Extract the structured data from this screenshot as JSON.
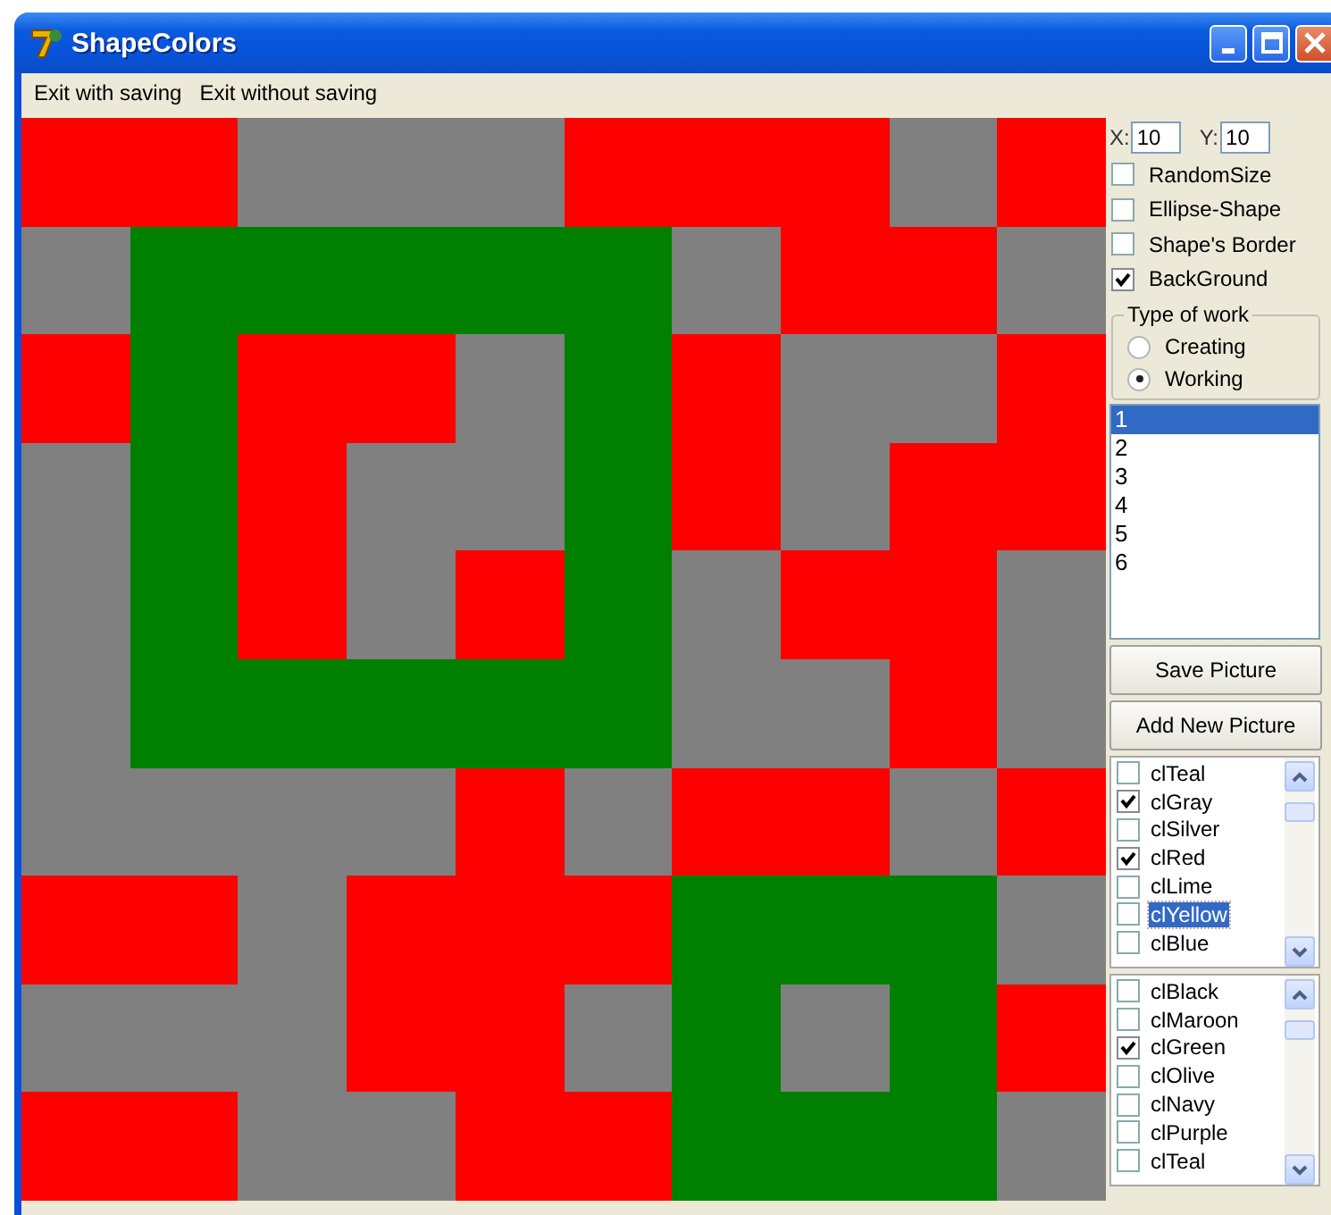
{
  "window": {
    "title": "ShapeColors"
  },
  "menu": [
    {
      "label": "Exit with saving"
    },
    {
      "label": "Exit without saving"
    }
  ],
  "canvas": {
    "rows": [
      {
        "cells": [
          {
            "color": "#ff0000"
          },
          {
            "color": "#ff0000"
          },
          {
            "color": "#808080"
          },
          {
            "color": "#808080"
          },
          {
            "color": "#808080"
          },
          {
            "color": "#ff0000"
          },
          {
            "color": "#ff0000"
          },
          {
            "color": "#ff0000"
          },
          {
            "color": "#808080"
          },
          {
            "color": "#ff0000"
          }
        ]
      },
      {
        "cells": [
          {
            "color": "#808080"
          },
          {
            "color": "#008000"
          },
          {
            "color": "#008000"
          },
          {
            "color": "#008000"
          },
          {
            "color": "#008000"
          },
          {
            "color": "#008000"
          },
          {
            "color": "#808080"
          },
          {
            "color": "#ff0000"
          },
          {
            "color": "#ff0000"
          },
          {
            "color": "#808080"
          }
        ]
      },
      {
        "cells": [
          {
            "color": "#ff0000"
          },
          {
            "color": "#008000"
          },
          {
            "color": "#ff0000"
          },
          {
            "color": "#ff0000"
          },
          {
            "color": "#808080"
          },
          {
            "color": "#008000"
          },
          {
            "color": "#ff0000"
          },
          {
            "color": "#808080"
          },
          {
            "color": "#808080"
          },
          {
            "color": "#ff0000"
          }
        ]
      },
      {
        "cells": [
          {
            "color": "#808080"
          },
          {
            "color": "#008000"
          },
          {
            "color": "#ff0000"
          },
          {
            "color": "#808080"
          },
          {
            "color": "#808080"
          },
          {
            "color": "#008000"
          },
          {
            "color": "#ff0000"
          },
          {
            "color": "#808080"
          },
          {
            "color": "#ff0000"
          },
          {
            "color": "#ff0000"
          }
        ]
      },
      {
        "cells": [
          {
            "color": "#808080"
          },
          {
            "color": "#008000"
          },
          {
            "color": "#ff0000"
          },
          {
            "color": "#808080"
          },
          {
            "color": "#ff0000"
          },
          {
            "color": "#008000"
          },
          {
            "color": "#808080"
          },
          {
            "color": "#ff0000"
          },
          {
            "color": "#ff0000"
          },
          {
            "color": "#808080"
          }
        ]
      },
      {
        "cells": [
          {
            "color": "#808080"
          },
          {
            "color": "#008000"
          },
          {
            "color": "#008000"
          },
          {
            "color": "#008000"
          },
          {
            "color": "#008000"
          },
          {
            "color": "#008000"
          },
          {
            "color": "#808080"
          },
          {
            "color": "#808080"
          },
          {
            "color": "#ff0000"
          },
          {
            "color": "#808080"
          }
        ]
      },
      {
        "cells": [
          {
            "color": "#808080"
          },
          {
            "color": "#808080"
          },
          {
            "color": "#808080"
          },
          {
            "color": "#808080"
          },
          {
            "color": "#ff0000"
          },
          {
            "color": "#808080"
          },
          {
            "color": "#ff0000"
          },
          {
            "color": "#ff0000"
          },
          {
            "color": "#808080"
          },
          {
            "color": "#ff0000"
          }
        ]
      },
      {
        "cells": [
          {
            "color": "#ff0000"
          },
          {
            "color": "#ff0000"
          },
          {
            "color": "#808080"
          },
          {
            "color": "#ff0000"
          },
          {
            "color": "#ff0000"
          },
          {
            "color": "#ff0000"
          },
          {
            "color": "#008000"
          },
          {
            "color": "#008000"
          },
          {
            "color": "#008000"
          },
          {
            "color": "#808080"
          }
        ]
      },
      {
        "cells": [
          {
            "color": "#808080"
          },
          {
            "color": "#808080"
          },
          {
            "color": "#808080"
          },
          {
            "color": "#ff0000"
          },
          {
            "color": "#ff0000"
          },
          {
            "color": "#808080"
          },
          {
            "color": "#008000"
          },
          {
            "color": "#808080"
          },
          {
            "color": "#008000"
          },
          {
            "color": "#ff0000"
          }
        ]
      },
      {
        "cells": [
          {
            "color": "#ff0000"
          },
          {
            "color": "#ff0000"
          },
          {
            "color": "#808080"
          },
          {
            "color": "#808080"
          },
          {
            "color": "#ff0000"
          },
          {
            "color": "#ff0000"
          },
          {
            "color": "#008000"
          },
          {
            "color": "#008000"
          },
          {
            "color": "#008000"
          },
          {
            "color": "#808080"
          }
        ]
      }
    ]
  },
  "position": {
    "x_label": "X:",
    "x_value": "10",
    "y_label": "Y:",
    "y_value": "10"
  },
  "options": [
    {
      "label": "RandomSize",
      "checked": false
    },
    {
      "label": "Ellipse-Shape",
      "checked": false
    },
    {
      "label": "Shape's Border",
      "checked": false
    },
    {
      "label": "BackGround",
      "checked": true
    }
  ],
  "type_of_work": {
    "title": "Type of work",
    "options": [
      {
        "label": "Creating",
        "selected": false
      },
      {
        "label": "Working",
        "selected": true
      }
    ]
  },
  "pictures": [
    {
      "label": "1",
      "selected": true
    },
    {
      "label": "2",
      "selected": false
    },
    {
      "label": "3",
      "selected": false
    },
    {
      "label": "4",
      "selected": false
    },
    {
      "label": "5",
      "selected": false
    },
    {
      "label": "6",
      "selected": false
    }
  ],
  "buttons": [
    {
      "label": "Save Picture"
    },
    {
      "label": "Add New Picture"
    }
  ],
  "color_lists": [
    {
      "items": [
        {
          "label": "clTeal",
          "checked": false,
          "selected": false
        },
        {
          "label": "clGray",
          "checked": true,
          "selected": false
        },
        {
          "label": "clSilver",
          "checked": false,
          "selected": false
        },
        {
          "label": "clRed",
          "checked": true,
          "selected": false
        },
        {
          "label": "clLime",
          "checked": false,
          "selected": false
        },
        {
          "label": "clYellow",
          "checked": false,
          "selected": true
        },
        {
          "label": "clBlue",
          "checked": false,
          "selected": false
        }
      ]
    },
    {
      "items": [
        {
          "label": "clBlack",
          "checked": false,
          "selected": false
        },
        {
          "label": "clMaroon",
          "checked": false,
          "selected": false
        },
        {
          "label": "clGreen",
          "checked": true,
          "selected": false
        },
        {
          "label": "clOlive",
          "checked": false,
          "selected": false
        },
        {
          "label": "clNavy",
          "checked": false,
          "selected": false
        },
        {
          "label": "clPurple",
          "checked": false,
          "selected": false
        },
        {
          "label": "clTeal",
          "checked": false,
          "selected": false
        }
      ]
    }
  ]
}
